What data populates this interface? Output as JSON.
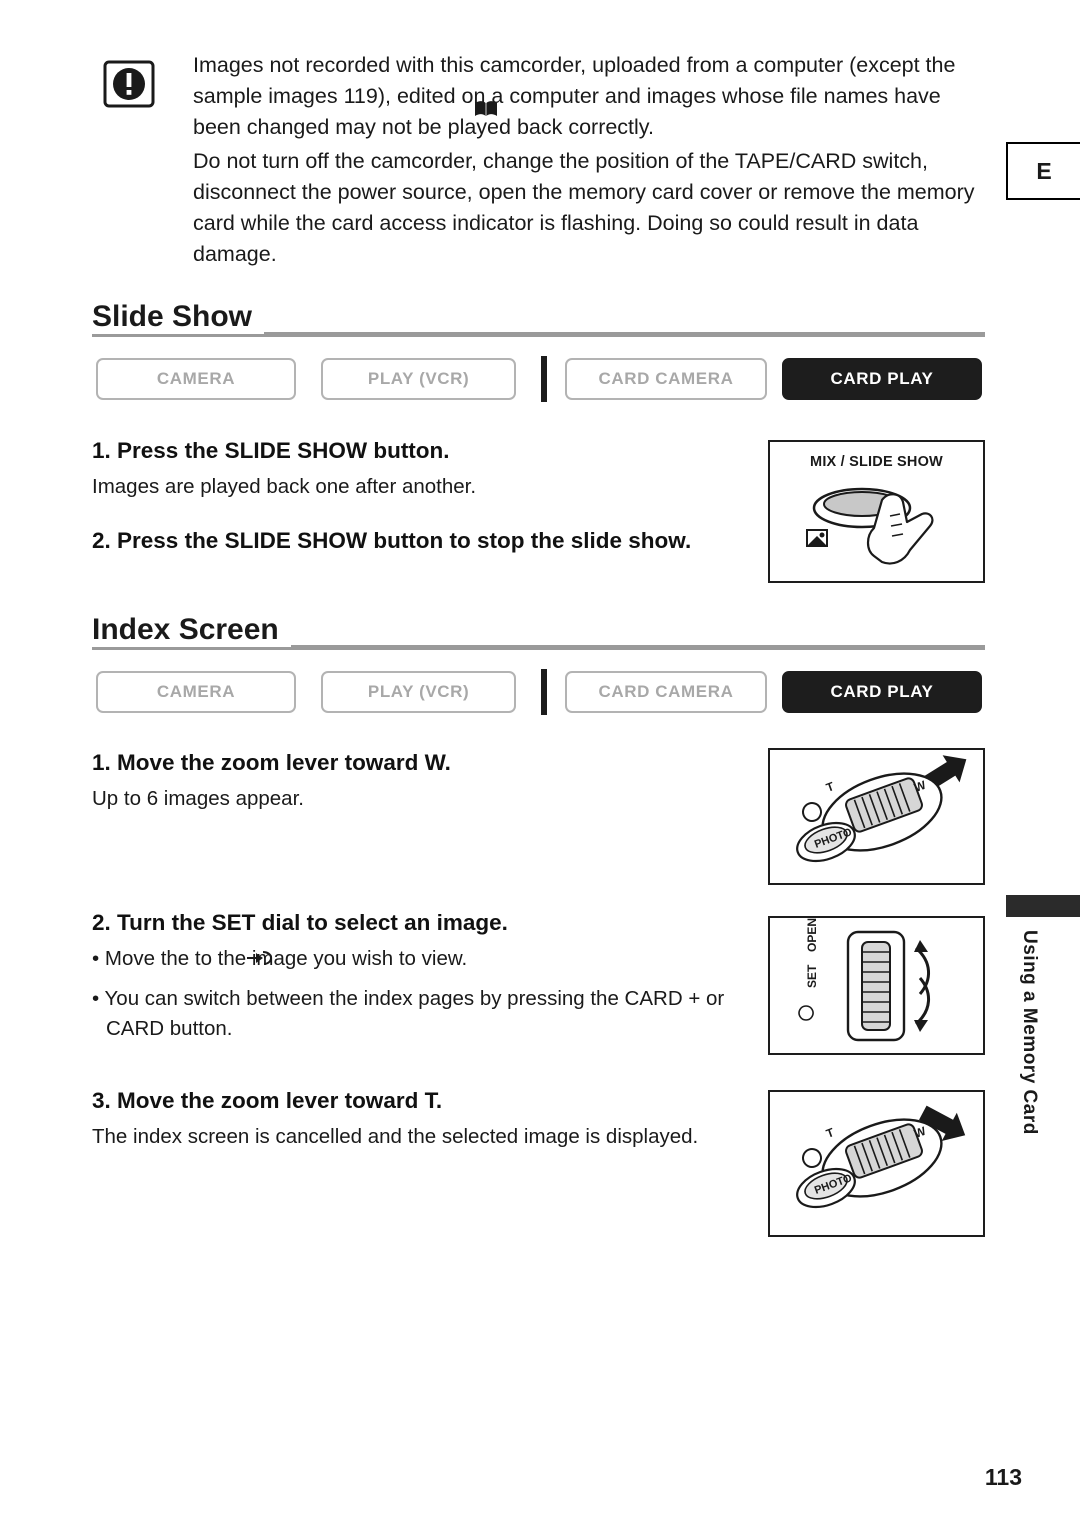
{
  "warning": {
    "icon": "warning-exclamation-icon",
    "paragraphs": [
      "Images not recorded with this camcorder, uploaded from a computer (except the sample images  119), edited on a computer and images whose file names have been changed may not be played back correctly.",
      "Do not turn off the camcorder, change the position of the TAPE/CARD switch, disconnect the power source, open the memory card cover or remove the memory card while the card access indicator is flashing. Doing so could result in data damage."
    ],
    "page_ref": "119"
  },
  "edge_tab": {
    "label": "E"
  },
  "sections": [
    {
      "id": "slide-show",
      "title": "Slide Show",
      "modes": [
        {
          "label": "CAMERA",
          "active": false
        },
        {
          "label": "PLAY (VCR)",
          "active": false
        },
        {
          "label": "CARD CAMERA",
          "active": false
        },
        {
          "label": "CARD PLAY",
          "active": true
        }
      ],
      "steps": [
        {
          "title": "1. Press the SLIDE SHOW button.",
          "body": [
            "Images are played back one after another."
          ]
        },
        {
          "title": "2. Press the SLIDE SHOW button to stop the slide show.",
          "body": []
        }
      ],
      "illustration": {
        "caption": "MIX / SLIDE SHOW",
        "name": "slide-show-button-illustration"
      }
    },
    {
      "id": "index-screen",
      "title": "Index Screen",
      "modes": [
        {
          "label": "CAMERA",
          "active": false
        },
        {
          "label": "PLAY (VCR)",
          "active": false
        },
        {
          "label": "CARD CAMERA",
          "active": false
        },
        {
          "label": "CARD PLAY",
          "active": true
        }
      ],
      "steps": [
        {
          "title": "1. Move the zoom lever toward W.",
          "body": [
            "Up to 6 images appear."
          ]
        },
        {
          "title": "2. Turn the SET dial to select an image.",
          "body": [
            "• Move the  to the image you wish to view.",
            "• You can switch between the index pages by pressing the CARD + or CARD  button."
          ]
        },
        {
          "title": "3. Move the zoom lever toward T.",
          "body": [
            "The index screen is cancelled and the selected image is displayed."
          ]
        }
      ],
      "illustrations": [
        {
          "name": "zoom-lever-wide-illustration",
          "labels": [
            "W",
            "T",
            "PHOTO"
          ]
        },
        {
          "name": "set-dial-illustration",
          "labels": [
            "OPEN",
            "SET"
          ]
        },
        {
          "name": "zoom-lever-tele-illustration",
          "labels": [
            "W",
            "T",
            "PHOTO"
          ]
        }
      ]
    }
  ],
  "side_label": "Using a Memory Card",
  "page_number": "113"
}
